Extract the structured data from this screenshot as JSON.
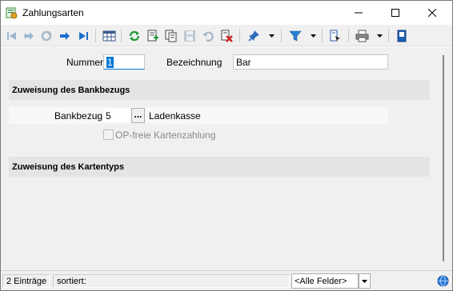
{
  "window": {
    "title": "Zahlungsarten",
    "minimize_icon": "minimize-icon",
    "maximize_icon": "maximize-icon",
    "close_icon": "close-icon"
  },
  "toolbar": {
    "icons": [
      "first-record-icon",
      "previous-record-icon",
      "refresh-disabled-icon",
      "next-record-icon",
      "last-record-icon",
      "table-view-icon",
      "refresh-icon",
      "new-record-icon",
      "copy-record-icon",
      "save-icon",
      "undo-icon",
      "delete-icon",
      "pin-icon",
      "filter-icon",
      "export-icon",
      "print-icon",
      "notes-icon"
    ]
  },
  "form": {
    "nummer_label": "Nummer",
    "nummer_value": "1",
    "bezeichnung_label": "Bezeichnung",
    "bezeichnung_value": "Bar",
    "section_bank": "Zuweisung des Bankbezugs",
    "bankbezug_label": "Bankbezug",
    "bankbezug_value": "5",
    "bankbezug_browse": "...",
    "bankbezug_name": "Ladenkasse",
    "op_checkbox_label": "OP-freie Kartenzahlung",
    "op_checkbox_checked": false,
    "section_card": "Zuweisung des Kartentyps"
  },
  "status": {
    "entries": "2 Einträge",
    "sorted": "sortiert:",
    "field_filter": "<Alle Felder>"
  },
  "colors": {
    "accent": "#0078d7",
    "section_bg": "#e4e4e4",
    "content_bg": "#f0f0f0"
  }
}
